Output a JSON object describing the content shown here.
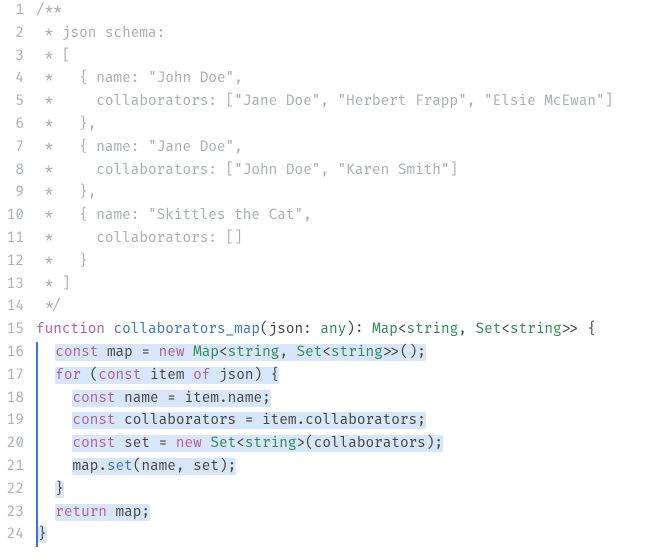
{
  "lines": [
    {
      "n": 1,
      "kind": "comment",
      "text": "/**"
    },
    {
      "n": 2,
      "kind": "comment",
      "text": " * json schema:"
    },
    {
      "n": 3,
      "kind": "comment",
      "text": " * ["
    },
    {
      "n": 4,
      "kind": "comment",
      "text": " *   { name: \"John Doe\","
    },
    {
      "n": 5,
      "kind": "comment",
      "text": " *     collaborators: [\"Jane Doe\", \"Herbert Frapp\", \"Elsie McEwan\"]"
    },
    {
      "n": 6,
      "kind": "comment",
      "text": " *   },"
    },
    {
      "n": 7,
      "kind": "comment",
      "text": " *   { name: \"Jane Doe\","
    },
    {
      "n": 8,
      "kind": "comment",
      "text": " *     collaborators: [\"John Doe\", \"Karen Smith\"]"
    },
    {
      "n": 9,
      "kind": "comment",
      "text": " *   },"
    },
    {
      "n": 10,
      "kind": "comment",
      "text": " *   { name: \"Skittles the Cat\","
    },
    {
      "n": 11,
      "kind": "comment",
      "text": " *     collaborators: []"
    },
    {
      "n": 12,
      "kind": "comment",
      "text": " *   }"
    },
    {
      "n": 13,
      "kind": "comment",
      "text": " * ]"
    },
    {
      "n": 14,
      "kind": "comment",
      "text": " */"
    },
    {
      "n": 15,
      "kind": "code",
      "hl": false,
      "segments": [
        {
          "t": "function ",
          "c": "kw"
        },
        {
          "t": "collaborators_map",
          "c": "fn"
        },
        {
          "t": "(",
          "c": "punct"
        },
        {
          "t": "json",
          "c": "ident"
        },
        {
          "t": ": ",
          "c": "punct"
        },
        {
          "t": "any",
          "c": "type"
        },
        {
          "t": ")",
          "c": "punct"
        },
        {
          "t": ": ",
          "c": "punct"
        },
        {
          "t": "Map",
          "c": "type"
        },
        {
          "t": "<",
          "c": "angle"
        },
        {
          "t": "string",
          "c": "type"
        },
        {
          "t": ", ",
          "c": "punct"
        },
        {
          "t": "Set",
          "c": "type"
        },
        {
          "t": "<",
          "c": "angle"
        },
        {
          "t": "string",
          "c": "type"
        },
        {
          "t": ">>",
          "c": "angle"
        },
        {
          "t": " {",
          "c": "punct"
        }
      ]
    },
    {
      "n": 16,
      "kind": "code",
      "hl": true,
      "indent": "  ",
      "segments": [
        {
          "t": "const ",
          "c": "kw"
        },
        {
          "t": "map",
          "c": "ident"
        },
        {
          "t": " = ",
          "c": "punct"
        },
        {
          "t": "new ",
          "c": "kw"
        },
        {
          "t": "Map",
          "c": "type"
        },
        {
          "t": "<",
          "c": "angle"
        },
        {
          "t": "string",
          "c": "type"
        },
        {
          "t": ", ",
          "c": "punct"
        },
        {
          "t": "Set",
          "c": "type"
        },
        {
          "t": "<",
          "c": "angle"
        },
        {
          "t": "string",
          "c": "type"
        },
        {
          "t": ">>",
          "c": "angle"
        },
        {
          "t": "();",
          "c": "punct"
        }
      ]
    },
    {
      "n": 17,
      "kind": "code",
      "hl": true,
      "indent": "  ",
      "segments": [
        {
          "t": "for ",
          "c": "kw"
        },
        {
          "t": "(",
          "c": "punct"
        },
        {
          "t": "const ",
          "c": "kw"
        },
        {
          "t": "item",
          "c": "ident"
        },
        {
          "t": " of ",
          "c": "kw"
        },
        {
          "t": "json",
          "c": "ident"
        },
        {
          "t": ") {",
          "c": "punct"
        }
      ]
    },
    {
      "n": 18,
      "kind": "code",
      "hl": true,
      "indent": "    ",
      "segments": [
        {
          "t": "const ",
          "c": "kw"
        },
        {
          "t": "name",
          "c": "ident"
        },
        {
          "t": " = ",
          "c": "punct"
        },
        {
          "t": "item",
          "c": "ident"
        },
        {
          "t": ".",
          "c": "punct"
        },
        {
          "t": "name",
          "c": "prop"
        },
        {
          "t": ";",
          "c": "punct"
        }
      ]
    },
    {
      "n": 19,
      "kind": "code",
      "hl": true,
      "indent": "    ",
      "segments": [
        {
          "t": "const ",
          "c": "kw"
        },
        {
          "t": "collaborators",
          "c": "ident"
        },
        {
          "t": " = ",
          "c": "punct"
        },
        {
          "t": "item",
          "c": "ident"
        },
        {
          "t": ".",
          "c": "punct"
        },
        {
          "t": "collaborators",
          "c": "prop"
        },
        {
          "t": ";",
          "c": "punct"
        }
      ]
    },
    {
      "n": 20,
      "kind": "code",
      "hl": true,
      "indent": "    ",
      "segments": [
        {
          "t": "const ",
          "c": "kw"
        },
        {
          "t": "set",
          "c": "ident"
        },
        {
          "t": " = ",
          "c": "punct"
        },
        {
          "t": "new ",
          "c": "kw"
        },
        {
          "t": "Set",
          "c": "type"
        },
        {
          "t": "<",
          "c": "angle"
        },
        {
          "t": "string",
          "c": "type"
        },
        {
          "t": ">",
          "c": "angle"
        },
        {
          "t": "(",
          "c": "punct"
        },
        {
          "t": "collaborators",
          "c": "ident"
        },
        {
          "t": ");",
          "c": "punct"
        }
      ]
    },
    {
      "n": 21,
      "kind": "code",
      "hl": true,
      "indent": "    ",
      "segments": [
        {
          "t": "map",
          "c": "ident"
        },
        {
          "t": ".",
          "c": "punct"
        },
        {
          "t": "set",
          "c": "method"
        },
        {
          "t": "(",
          "c": "punct"
        },
        {
          "t": "name",
          "c": "ident"
        },
        {
          "t": ", ",
          "c": "punct"
        },
        {
          "t": "set",
          "c": "ident"
        },
        {
          "t": ");",
          "c": "punct"
        }
      ]
    },
    {
      "n": 22,
      "kind": "code",
      "hl": true,
      "indent": "  ",
      "segments": [
        {
          "t": "}",
          "c": "punct"
        }
      ]
    },
    {
      "n": 23,
      "kind": "code",
      "hl": true,
      "indent": "  ",
      "segments": [
        {
          "t": "return ",
          "c": "kw"
        },
        {
          "t": "map",
          "c": "ident"
        },
        {
          "t": ";",
          "c": "punct"
        }
      ]
    },
    {
      "n": 24,
      "kind": "code",
      "hl": true,
      "indent": "",
      "segments": [
        {
          "t": "}",
          "c": "punct"
        }
      ]
    }
  ]
}
